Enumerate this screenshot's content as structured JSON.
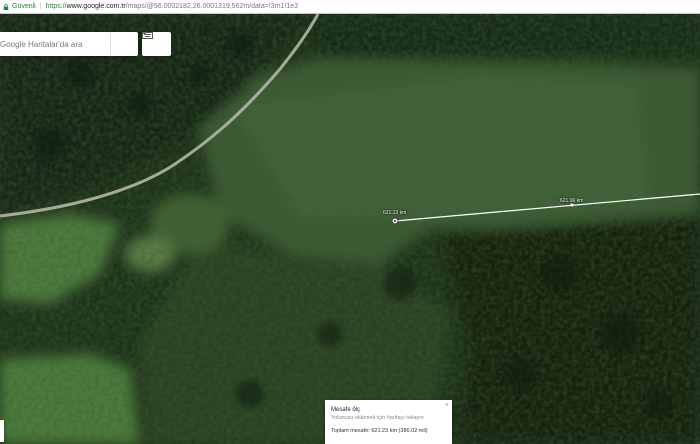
{
  "browser": {
    "security_label": "Güvenli",
    "url_protocol": "https://",
    "url_host": "www.google.com.tr",
    "url_path": "/maps/@56.0002182,26.0001319,562m/data=!3m1!1e3"
  },
  "search": {
    "placeholder": "Google Haritalar'da ara",
    "icon": "search-icon"
  },
  "directions": {
    "icon": "directions-icon"
  },
  "layers": {
    "icon": "keyboard-icon"
  },
  "map": {
    "type": "satellite",
    "measure_labels": {
      "start": "621.23 km",
      "segment": "621.06 km"
    }
  },
  "measure_card": {
    "title": "Mesafe ölç",
    "hint": "Yolunuzu eklemek için haritayı tıklayın",
    "total": "Toplam mesafe: 621.23 km (386.02 mil)",
    "close": "×"
  },
  "colors": {
    "forest_dark": "#162914",
    "forest_mid": "#2b4526",
    "meadow": "#4a7a3a",
    "road": "#b4b6a8",
    "measure_line": "#ffffff"
  }
}
